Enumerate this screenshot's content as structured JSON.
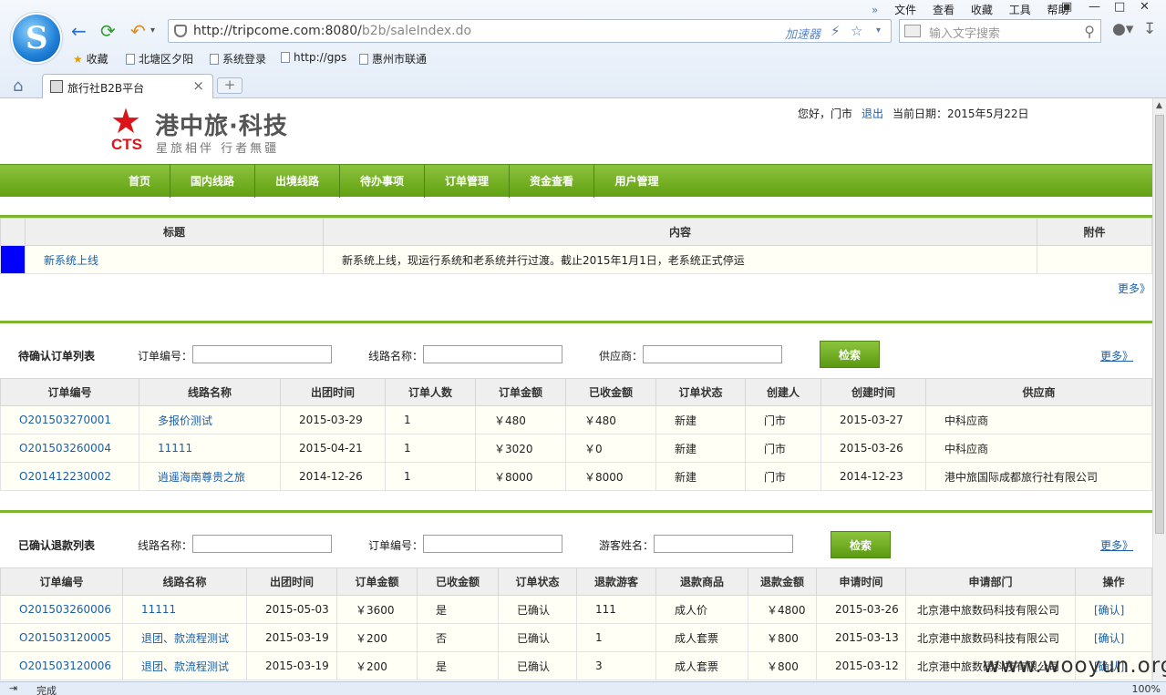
{
  "browser": {
    "menus": [
      "文件",
      "查看",
      "收藏",
      "工具",
      "帮助"
    ],
    "url_host": "http://tripcome.com:8080/",
    "url_path": "b2b/saleIndex.do",
    "accelerator": "加速器",
    "search_placeholder": "输入文字搜索",
    "bookmarks": [
      "收藏",
      "北塘区夕阳",
      "系统登录",
      "http://gps",
      "惠州市联通"
    ],
    "tab_title": "旅行社B2B平台",
    "status_text": "完成",
    "zoom": "100%"
  },
  "header": {
    "logo_letters": "CTS",
    "brand": "港中旅·科技",
    "slogan": "星旅相伴 行者無疆",
    "greeting": "您好，门市",
    "logout": "退出",
    "date_label": "当前日期：2015年5月22日"
  },
  "nav": [
    "首页",
    "国内线路",
    "出境线路",
    "待办事项",
    "订单管理",
    "资金查看",
    "用户管理"
  ],
  "notice": {
    "headers": [
      "标题",
      "内容",
      "附件"
    ],
    "rows": [
      {
        "title": "新系统上线",
        "content": "新系统上线，现运行系统和老系统并行过渡。截止2015年1月1日，老系统正式停运",
        "attachment": ""
      }
    ],
    "more": "更多》"
  },
  "pending": {
    "title": "待确认订单列表",
    "filters": [
      "订单编号：",
      "线路名称：",
      "供应商："
    ],
    "search": "检索",
    "more": "更多》",
    "headers": [
      "订单编号",
      "线路名称",
      "出团时间",
      "订单人数",
      "订单金额",
      "已收金额",
      "订单状态",
      "创建人",
      "创建时间",
      "供应商"
    ],
    "rows": [
      [
        "O201503270001",
        "多报价测试",
        "2015-03-29",
        "1",
        "￥480",
        "￥480",
        "新建",
        "门市",
        "2015-03-27",
        "中科应商"
      ],
      [
        "O201503260004",
        "11111",
        "2015-04-21",
        "1",
        "￥3020",
        "￥0",
        "新建",
        "门市",
        "2015-03-26",
        "中科应商"
      ],
      [
        "O201412230002",
        "逍遥海南尊贵之旅",
        "2014-12-26",
        "1",
        "￥8000",
        "￥8000",
        "新建",
        "门市",
        "2014-12-23",
        "港中旅国际成都旅行社有限公司"
      ]
    ]
  },
  "refund": {
    "title": "已确认退款列表",
    "filters": [
      "线路名称：",
      "订单编号：",
      "游客姓名："
    ],
    "search": "检索",
    "more": "更多》",
    "headers": [
      "订单编号",
      "线路名称",
      "出团时间",
      "订单金额",
      "已收金额",
      "订单状态",
      "退款游客",
      "退款商品",
      "退款金额",
      "申请时间",
      "申请部门",
      "操作"
    ],
    "rows": [
      [
        "O201503260006",
        "11111",
        "2015-05-03",
        "￥3600",
        "是",
        "已确认",
        "111",
        "成人价",
        "￥4800",
        "2015-03-26",
        "北京港中旅数码科技有限公司",
        "[确认]"
      ],
      [
        "O201503120005",
        "退团、款流程测试",
        "2015-03-19",
        "￥200",
        "否",
        "已确认",
        "1",
        "成人套票",
        "￥800",
        "2015-03-13",
        "北京港中旅数码科技有限公司",
        "[确认]"
      ],
      [
        "O201503120006",
        "退团、款流程测试",
        "2015-03-19",
        "￥200",
        "是",
        "已确认",
        "3",
        "成人套票",
        "￥800",
        "2015-03-12",
        "北京港中旅数码科技有限公司",
        "[确认]"
      ]
    ]
  },
  "watermark": "www.wooyun.org"
}
